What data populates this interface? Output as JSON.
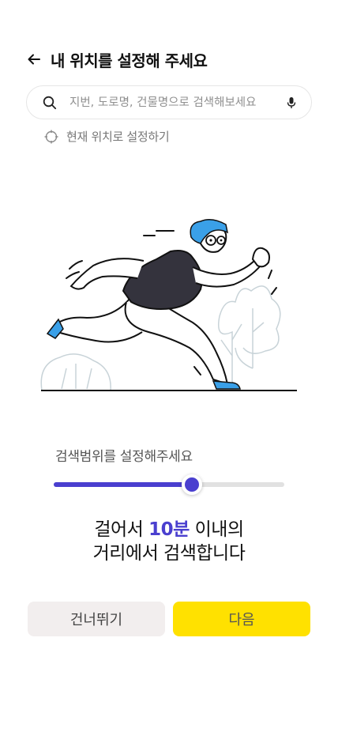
{
  "header": {
    "title": "내 위치를 설정해 주세요",
    "back_icon": "arrow-left-icon"
  },
  "search": {
    "placeholder": "지번, 도로명, 건물명으로 검색해보세요",
    "value": "",
    "icons": [
      "search-icon",
      "mic-icon"
    ]
  },
  "current_location": {
    "label": "현재 위치로 설정하기",
    "icon": "crosshair-icon"
  },
  "illustration": {
    "icon": "running-man-illustration"
  },
  "range": {
    "label": "검색범위를 설정해주세요",
    "slider_value": 0.6,
    "result_prefix": "걸어서 ",
    "result_highlight": "10분",
    "result_suffix": " 이내의",
    "result_line2": "거리에서 검색합니다"
  },
  "buttons": {
    "skip": "건너뛰기",
    "next": "다음"
  },
  "colors": {
    "accent": "#4a3fcf",
    "primary_button": "#ffe100",
    "secondary_button": "#f2eeee",
    "illustration_blue": "#3aa0e8"
  }
}
